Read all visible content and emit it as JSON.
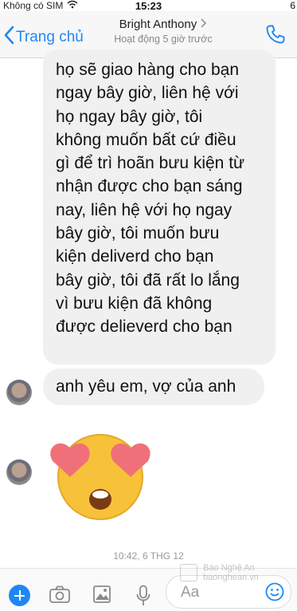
{
  "status_bar": {
    "carrier": "Không có SIM",
    "time": "15:23",
    "battery": "6"
  },
  "header": {
    "back_label": "Trang chủ",
    "contact_name": "Bright Anthony",
    "contact_status": "Hoạt động 5 giờ trước"
  },
  "messages": {
    "long_lines": [
      "họ sẽ giao hàng cho bạn",
      "ngay bây giờ, liên hệ với",
      "họ ngay bây giờ, tôi",
      "không muốn bất cứ điều",
      "gì để trì hoãn bưu kiện từ",
      "nhận được cho bạn sáng",
      "nay, liên hệ với họ ngay",
      "bây giờ, tôi muốn bưu",
      "kiện deliverd cho bạn",
      "bây giờ, tôi đã rất lo lắng",
      "vì bưu kiện đã không",
      "được delieverd cho bạn"
    ],
    "short": "anh yêu em, vợ của anh",
    "timestamp": "10:42, 6 THG 12"
  },
  "composer": {
    "placeholder": "Aa"
  },
  "watermark": {
    "line1": "Báo Nghệ An",
    "line2": "baonghean.vn"
  },
  "colors": {
    "accent": "#1f87f5",
    "bubble": "#f1f0f0",
    "emoji_face": "#f7c23a",
    "heart": "#f0707a"
  }
}
